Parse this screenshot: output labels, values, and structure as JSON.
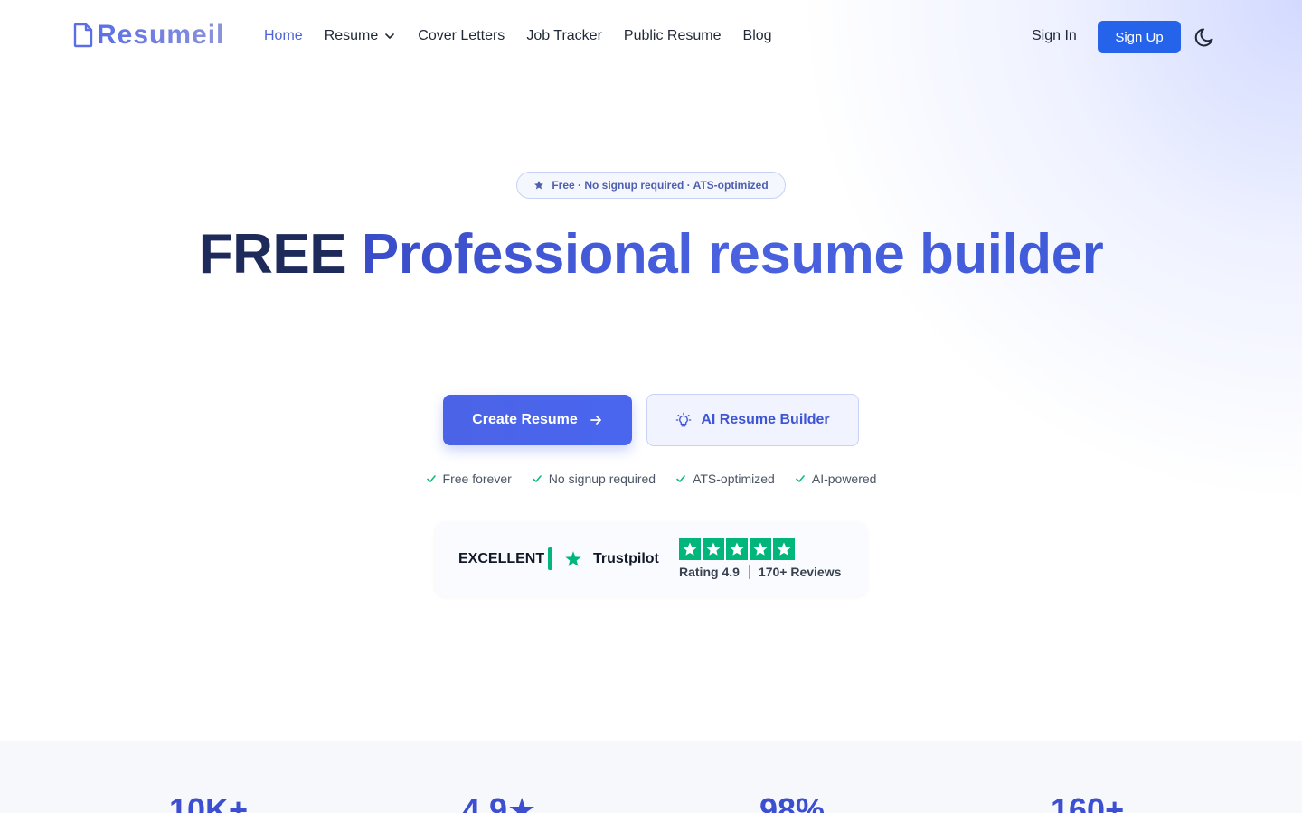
{
  "brand": {
    "name": "Resumeil"
  },
  "nav": {
    "links": [
      {
        "label": "Home"
      },
      {
        "label": "Resume"
      },
      {
        "label": "Cover Letters"
      },
      {
        "label": "Job Tracker"
      },
      {
        "label": "Public Resume"
      },
      {
        "label": "Blog"
      }
    ],
    "sign_in": "Sign In",
    "sign_up": "Sign Up"
  },
  "hero": {
    "badge": "Free · No signup required · ATS-optimized",
    "title_part1": "FREE ",
    "title_part2": "Professional resume builder",
    "primary_cta": "Create Resume",
    "secondary_cta": "AI Resume Builder",
    "features": [
      "Free forever",
      "No signup required",
      "ATS-optimized",
      "AI-powered"
    ]
  },
  "trustpilot": {
    "verdict": "EXCELLENT",
    "name": "Trustpilot",
    "rating_label": "Rating 4.9",
    "reviews_label": "170+ Reviews",
    "stars": 5
  },
  "stats": [
    "10K+",
    "4.9★",
    "98%",
    "160+"
  ],
  "colors": {
    "accent": "#2563eb",
    "brand": "#4b63e6",
    "trustpilot": "#00b67a"
  }
}
